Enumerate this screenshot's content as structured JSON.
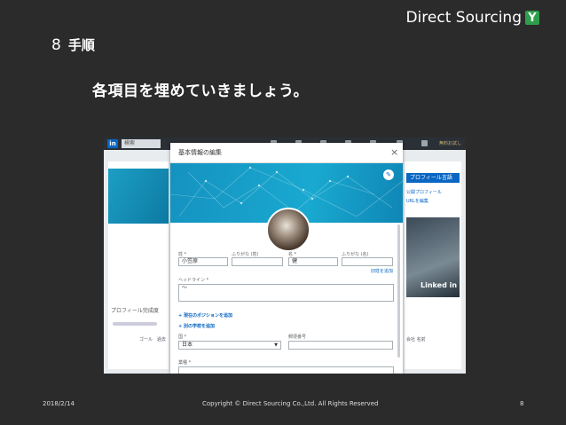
{
  "brand": {
    "name": "Direct Sourcing",
    "logo_glyph": "Y"
  },
  "step": {
    "number": "8",
    "title": "手順"
  },
  "subtitle": "各項目を埋めていきましょう。",
  "screenshot": {
    "linkedin_logo": "in",
    "search_placeholder": "検索",
    "premium_label": "無料お試し",
    "left_card_text": "プロフィール完成度",
    "left_card_item": "ゴール　過去",
    "right_btn_label": "プロフィール言語",
    "right_link1": "公開プロフィール",
    "right_link2": "URLを編集",
    "right_ad_text": "Linked in",
    "right_small": "会社 名前",
    "modal": {
      "title": "基本情報の編集",
      "close": "×",
      "edit_icon": "✎",
      "last_name_label": "姓 *",
      "last_name_value": "小笠原",
      "last_furigana_label": "ふりがな (姓)",
      "first_name_label": "名 *",
      "first_name_value": "健",
      "first_furigana_label": "ふりがな (名)",
      "add_former_name": "旧姓を追加",
      "headline_label": "ヘッドライン *",
      "headline_value": "～",
      "add_position": "現在のポジションを追加",
      "add_education": "別の学校を追加",
      "country_label": "国 *",
      "country_value": "日本",
      "postal_label": "郵便番号",
      "postal_value": "",
      "industry_label": "業種 *"
    }
  },
  "footer": {
    "date": "2018/2/14",
    "copyright": "Copyright © Direct Sourcing Co.,Ltd. All Rights Reserved",
    "page": "8"
  },
  "colors": {
    "background": "#2b2b2b",
    "brand_green": "#2e9e4a",
    "linkedin_blue": "#0a66c2",
    "banner": "#19a9d0"
  }
}
